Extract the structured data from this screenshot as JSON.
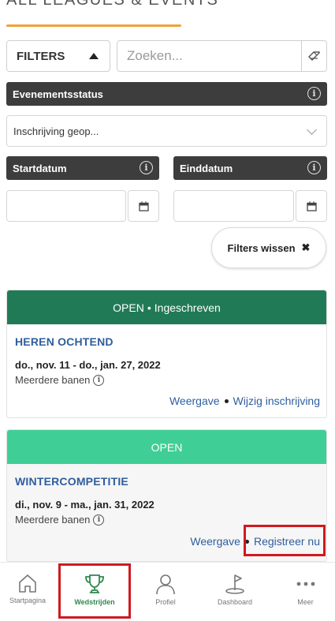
{
  "header": {
    "title": "ALL LEAGUES & EVENTS"
  },
  "filters": {
    "toggle_label": "FILTERS",
    "search_placeholder": "Zoeken...",
    "search_value": "",
    "status_label": "Evenementsstatus",
    "status_value": "Inschrijving geop...",
    "start_label": "Startdatum",
    "end_label": "Einddatum",
    "start_value": "",
    "end_value": "",
    "clear_label": "Filters wissen"
  },
  "events": [
    {
      "banner_status": "OPEN",
      "banner_extra": "Ingeschreven",
      "banner_color": "#217a56",
      "title": "HEREN OCHTEND",
      "dates": "do., nov. 11 - do., jan. 27, 2022",
      "courses": "Meerdere banen",
      "action_view": "Weergave",
      "action_primary": "Wijzig inschrijving"
    },
    {
      "banner_status": "OPEN",
      "banner_color": "#3fcf96",
      "title": "WINTERCOMPETITIE",
      "dates": "di., nov. 9 - ma., jan. 31, 2022",
      "courses": "Meerdere banen",
      "action_view": "Weergave",
      "action_primary": "Registreer nu"
    }
  ],
  "nav": {
    "items": [
      {
        "label": "Startpagina",
        "icon": "home-icon"
      },
      {
        "label": "Wedstrijden",
        "icon": "trophy-icon",
        "active": true
      },
      {
        "label": "Profiel",
        "icon": "person-icon"
      },
      {
        "label": "Dashboard",
        "icon": "golf-flag-icon"
      },
      {
        "label": "Meer",
        "icon": "more-dots-icon"
      }
    ]
  },
  "colors": {
    "accent_orange": "#f4a03a",
    "link_blue": "#2e5e9e",
    "active_green": "#2e8a4f",
    "highlight_red": "#d0191f",
    "dark_bar": "#3d3d3d"
  }
}
